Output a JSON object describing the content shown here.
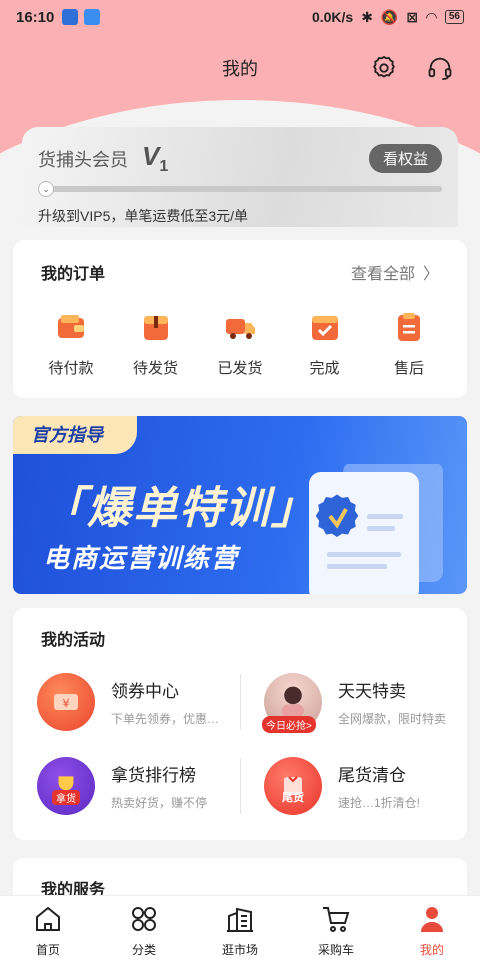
{
  "status_bar": {
    "time": "16:10",
    "speed": "0.0K/s",
    "battery": "56"
  },
  "header": {
    "title": "我的"
  },
  "vip": {
    "name": "货捕头会员",
    "level": "V",
    "level_num": "1",
    "rights_button": "看权益",
    "progress": 0.0,
    "tip": "升级到VIP5，单笔运费低至3元/单"
  },
  "orders": {
    "title": "我的订单",
    "view_all": "查看全部",
    "items": [
      {
        "label": "待付款",
        "icon": "wallet-icon"
      },
      {
        "label": "待发货",
        "icon": "box-icon"
      },
      {
        "label": "已发货",
        "icon": "truck-icon"
      },
      {
        "label": "完成",
        "icon": "check-icon"
      },
      {
        "label": "售后",
        "icon": "clipboard-icon"
      }
    ]
  },
  "banner": {
    "tag": "官方指导",
    "headline": "「爆单特训」",
    "subline": "电商运营训练营"
  },
  "activities": {
    "title": "我的活动",
    "items": [
      {
        "title": "领券中心",
        "desc": "下单先领券，优惠…",
        "icon": "coupon-icon"
      },
      {
        "title": "天天特卖",
        "desc": "全网爆款，限时特卖",
        "badge": "今日必抢>",
        "icon": "flash-sale-icon"
      },
      {
        "title": "拿货排行榜",
        "desc": "热卖好货，赚不停",
        "badge": "拿货",
        "icon": "trophy-icon"
      },
      {
        "title": "尾货清仓",
        "desc": "速抢…1折清仓!",
        "badge": "尾货",
        "icon": "clearance-icon"
      }
    ]
  },
  "services": {
    "title": "我的服务"
  },
  "tabbar": {
    "items": [
      {
        "label": "首页",
        "icon": "home-icon"
      },
      {
        "label": "分类",
        "icon": "category-icon"
      },
      {
        "label": "逛市场",
        "icon": "market-icon"
      },
      {
        "label": "采购车",
        "icon": "cart-icon"
      },
      {
        "label": "我的",
        "icon": "profile-icon",
        "active": true
      }
    ]
  },
  "colors": {
    "accent": "#e84b3a",
    "header_bg": "#fbb1b3",
    "banner_bg": "#2d6cf0"
  }
}
